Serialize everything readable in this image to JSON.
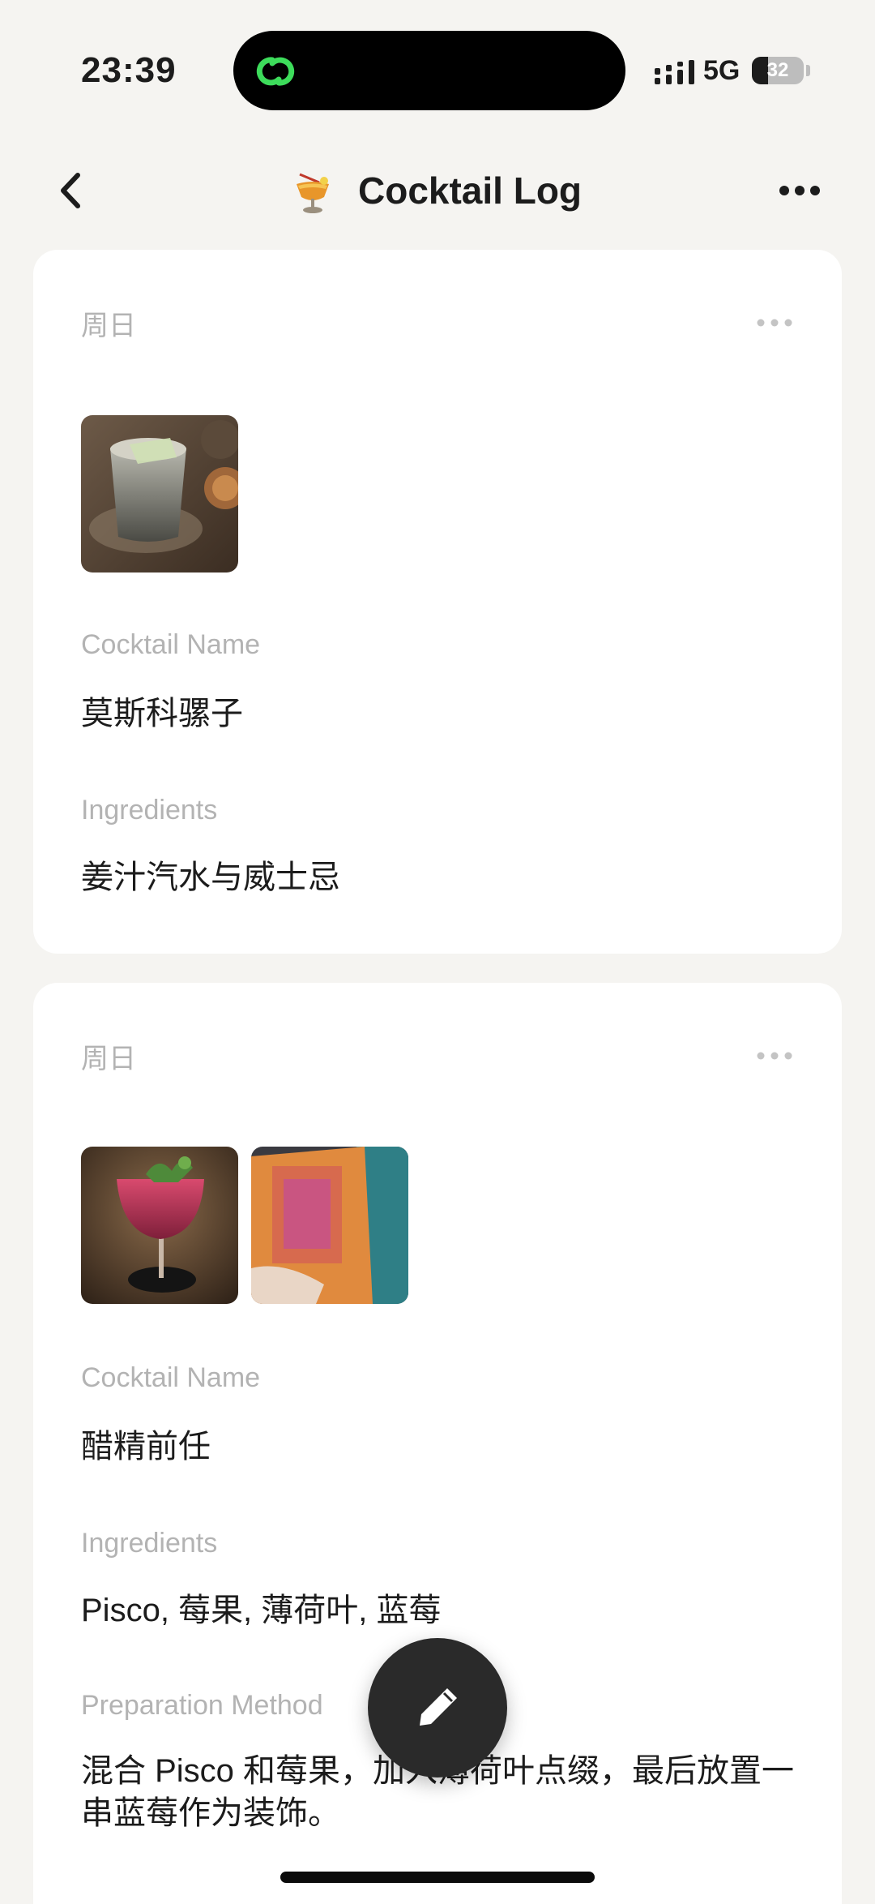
{
  "status_bar": {
    "time": "23:39",
    "network": "5G",
    "battery": "32",
    "battery_level": 0.32,
    "island_icon": "link-rings-icon"
  },
  "nav": {
    "back_icon": "chevron-left-icon",
    "title_icon": "tropical-drink-icon",
    "title": "Cocktail Log",
    "more_icon": "ellipsis-icon"
  },
  "entries": [
    {
      "day": "周日",
      "photos": [
        "cocktail-glass-photo"
      ],
      "fields": [
        {
          "label": "Cocktail Name",
          "value": "莫斯科骡子"
        },
        {
          "label": "Ingredients",
          "value": "姜汁汽水与威士忌"
        }
      ]
    },
    {
      "day": "周日",
      "photos": [
        "pink-cocktail-photo",
        "menu-card-photo"
      ],
      "fields": [
        {
          "label": "Cocktail Name",
          "value": "醋精前任"
        },
        {
          "label": "Ingredients",
          "value": "Pisco, 莓果, 薄荷叶, 蓝莓"
        },
        {
          "label": "Preparation Method",
          "value": "混合 Pisco 和莓果，加入薄荷叶点缀，最后放置一串蓝莓作为装饰。"
        }
      ]
    }
  ],
  "fab": {
    "icon": "pencil-icon"
  },
  "colors": {
    "background": "#f5f4f1",
    "card": "#ffffff",
    "label": "#b3b3b3",
    "text": "#1c1c1c",
    "fab": "#2a2a2a",
    "island_accent": "#3ddc5b"
  }
}
